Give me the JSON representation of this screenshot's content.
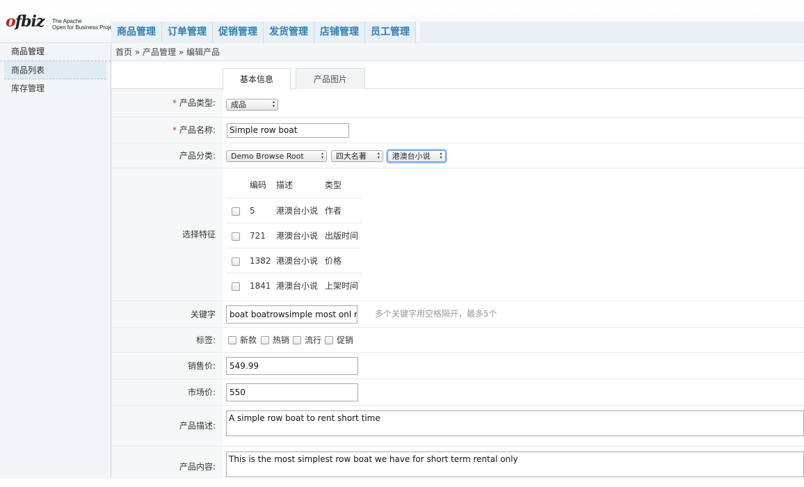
{
  "header": {
    "logo_word_prefix": "o",
    "logo_word_rest": "fbiz",
    "logo_sub_line1": "The Apache",
    "logo_sub_line2": "Open for Business Project",
    "nav": [
      "商品管理",
      "订单管理",
      "促销管理",
      "发货管理",
      "店铺管理",
      "员工管理"
    ]
  },
  "sidebar": {
    "title": "商品管理",
    "items": [
      "商品列表",
      "库存管理"
    ]
  },
  "breadcrumb": {
    "home": "首页",
    "sep": "»",
    "level1": "产品管理",
    "level2": "编辑产品"
  },
  "tabs": [
    "基本信息",
    "产品图片"
  ],
  "form": {
    "product_type": {
      "required_mark": "*",
      "label": "产品类型:",
      "value": "成品"
    },
    "product_name": {
      "required_mark": "*",
      "label": "产品名称:",
      "value": "Simple row boat"
    },
    "category": {
      "label": "产品分类:",
      "values": [
        "Demo Browse Root",
        "四大名著",
        "港澳台小说"
      ]
    },
    "features": {
      "label": "选择特征",
      "headers": [
        "编码",
        "描述",
        "类型"
      ],
      "rows": [
        {
          "code": "5",
          "desc": "港澳台小说",
          "type": "作者",
          "checked": false
        },
        {
          "code": "721",
          "desc": "港澳台小说",
          "type": "出版时间",
          "checked": false
        },
        {
          "code": "1382",
          "desc": "港澳台小说",
          "type": "价格",
          "checked": false
        },
        {
          "code": "1841",
          "desc": "港澳台小说",
          "type": "上架时间",
          "checked": false
        }
      ]
    },
    "keywords": {
      "label": "关键字",
      "value": "boat boatrowsimple most onl r",
      "hint": "多个关键字用空格隔开，最多5个"
    },
    "tags": {
      "label": "标签:",
      "options": [
        "新款",
        "热销",
        "流行",
        "促销"
      ]
    },
    "sale_price": {
      "label": "销售价:",
      "value": "549.99"
    },
    "market_price": {
      "label": "市场价:",
      "value": "550"
    },
    "description": {
      "label": "产品描述:",
      "value": "A simple row boat to rent short time"
    },
    "content": {
      "label": "产品内容:",
      "value": "This is the most simplest row boat we have for short term rental only"
    }
  },
  "colors": {
    "accent": "#2e7db4",
    "required": "#c0392b",
    "label_bg": "#f5f7f8"
  }
}
